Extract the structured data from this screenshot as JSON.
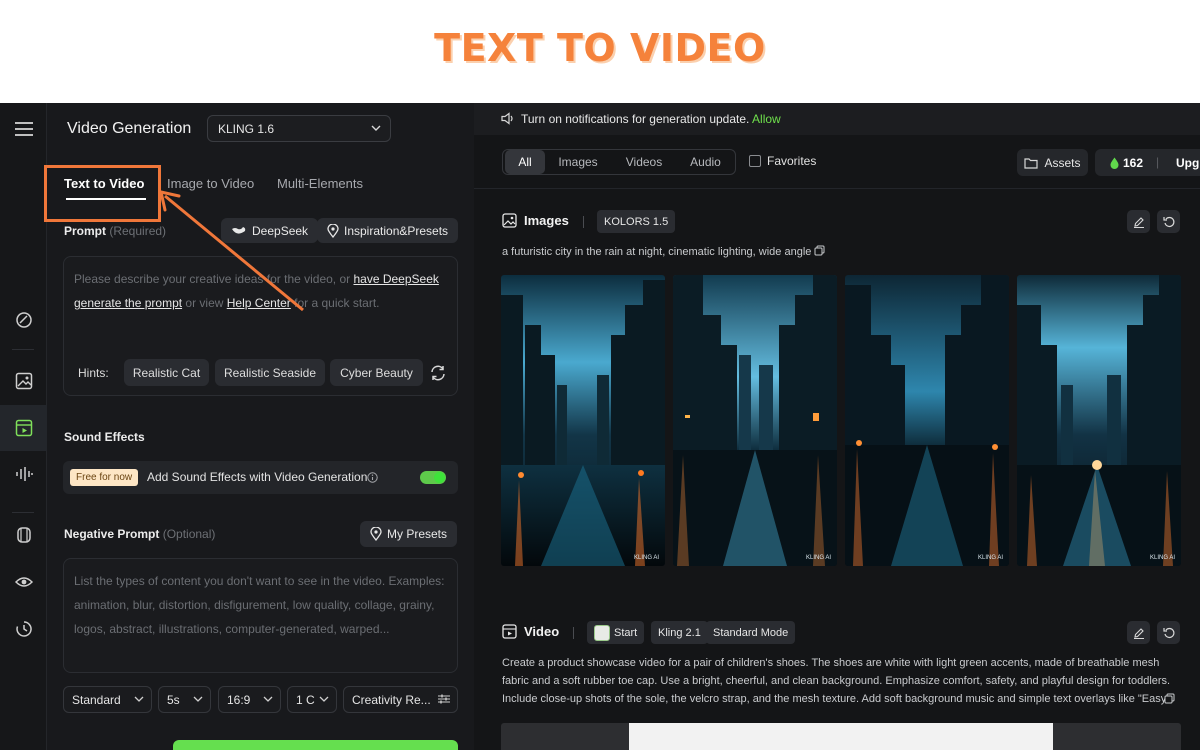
{
  "banner": {
    "title": "TEXT TO VIDEO"
  },
  "rail": {
    "items": [
      "menu-icon",
      "spark-icon",
      "image-icon",
      "video-icon",
      "audio-icon",
      "cube-icon",
      "eye-icon",
      "history-icon"
    ]
  },
  "panel": {
    "title": "Video Generation",
    "model": "KLING 1.6",
    "tabs": [
      "Text to Video",
      "Image to Video",
      "Multi-Elements"
    ],
    "prompt_label": "Prompt",
    "prompt_required": "(Required)",
    "deepseek_button": "DeepSeek",
    "inspiration_button": "Inspiration&Presets",
    "prompt_placeholder_1": "Please describe your creative ideas for the video, or ",
    "prompt_link_1": "have DeepSeek generate the prompt",
    "prompt_placeholder_2": " or view ",
    "prompt_link_2": "Help Center",
    "prompt_placeholder_3": " for a quick start.",
    "hints_label": "Hints:",
    "hints": [
      "Realistic Cat",
      "Realistic Seaside",
      "Cyber Beauty"
    ],
    "sound_label": "Sound Effects",
    "free_badge": "Free for now",
    "sound_text": "Add Sound Effects with Video Generation",
    "sound_on": true,
    "negative_label": "Negative Prompt",
    "negative_optional": "(Optional)",
    "my_presets": "My Presets",
    "negative_placeholder": "List the types of content you don't want to see in the video. Examples: animation, blur, distortion, disfigurement, low quality, collage, grainy, logos, abstract, illustrations, computer-generated, warped...",
    "settings": {
      "mode": "Standard",
      "duration": "5s",
      "ratio": "16:9",
      "count": "1 C",
      "creativity": "Creativity Re..."
    }
  },
  "content": {
    "notification": "Turn on notifications for generation update.",
    "allow": "Allow",
    "filters": [
      "All",
      "Images",
      "Videos",
      "Audio"
    ],
    "favorites": "Favorites",
    "assets": "Assets",
    "credits": "162",
    "upgrade": "Upgra",
    "images_section": {
      "title": "Images",
      "model_tag": "KOLORS 1.5",
      "caption": "a futuristic city in the rain at night, cinematic lighting, wide angle",
      "watermark": "KLING AI"
    },
    "video_section": {
      "title": "Video",
      "tags": [
        "Start",
        "Kling 2.1",
        "Standard Mode"
      ],
      "caption": "Create a product showcase video for a pair of children's shoes. The shoes are white with light green accents, made of breathable mesh fabric and a soft rubber toe cap. Use a bright, cheerful, and clean background. Emphasize comfort, safety, and playful design for toddlers. Include close-up shots of the sole, the velcro strap, and the mesh texture. Add soft background music and simple text overlays like \"Easy"
    }
  }
}
